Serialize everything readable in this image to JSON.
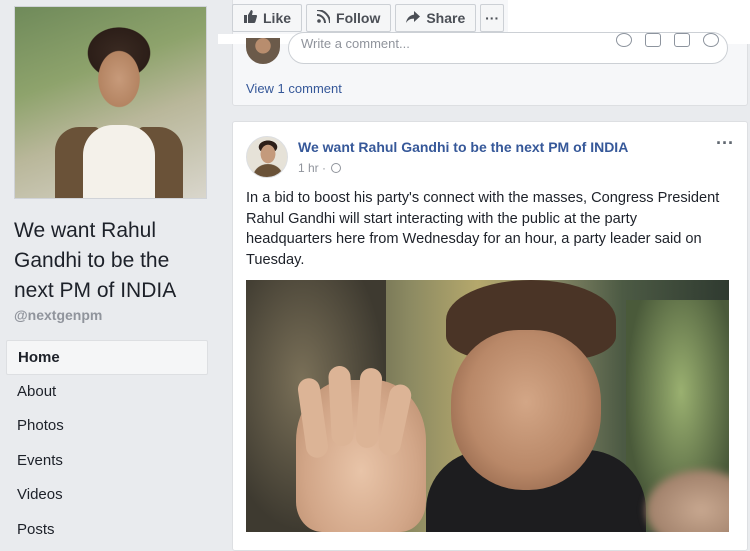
{
  "page": {
    "name": "We want Rahul Gandhi to be the next PM of INDIA",
    "handle": "@nextgenpm"
  },
  "sidebar": {
    "items": [
      {
        "label": "Home",
        "active": true
      },
      {
        "label": "About"
      },
      {
        "label": "Photos"
      },
      {
        "label": "Events"
      },
      {
        "label": "Videos"
      },
      {
        "label": "Posts"
      }
    ]
  },
  "actions": {
    "like": "Like",
    "follow": "Follow",
    "share": "Share",
    "more": "···"
  },
  "comments": {
    "placeholder": "Write a comment...",
    "view": "View 1 comment"
  },
  "post": {
    "author": "We want Rahul Gandhi to be the next PM of INDIA",
    "time": "1 hr ·",
    "menu": "···",
    "text": "In a bid to boost his party's connect with the masses, Congress President Rahul Gandhi will start interacting with the public at the party headquarters here from Wednesday for an hour, a party leader said on Tuesday."
  },
  "icons": {
    "like": "thumbs-up-icon",
    "follow": "rss-icon",
    "share": "share-arrow-icon",
    "privacy": "globe-icon"
  },
  "colors": {
    "link": "#365899",
    "background": "#e9ebee"
  }
}
